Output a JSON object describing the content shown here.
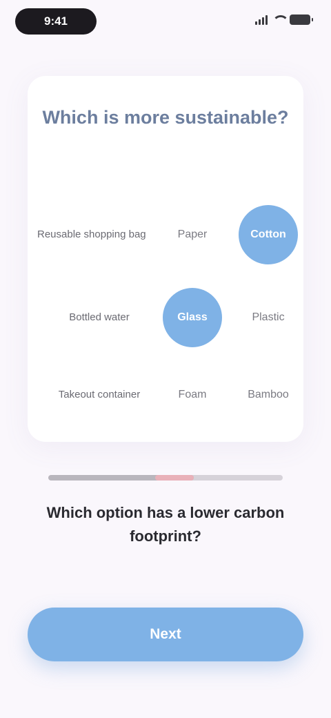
{
  "status_bar": {
    "time": "9:41",
    "icons": [
      "signal-icon",
      "wifi-icon",
      "battery-icon"
    ]
  },
  "card": {
    "title": "Which is more sustainable?",
    "rows": [
      {
        "label": "Reusable shopping bag",
        "option_a": "Paper",
        "option_b": "Cotton",
        "selected": "b"
      },
      {
        "label": "Bottled water",
        "option_a": "Glass",
        "option_b": "Plastic",
        "selected": "a"
      },
      {
        "label": "Takeout container",
        "option_a": "Foam",
        "option_b": "Bamboo",
        "selected": ""
      }
    ]
  },
  "question": {
    "text": "Which option has a lower carbon footprint?",
    "progress": 0.62
  },
  "continue_button": {
    "label": "Next"
  },
  "colors": {
    "accent": "#7fb2e6",
    "background": "#faf7fc",
    "title": "#6c7e9e",
    "progress_marker": "#e9b1b9"
  }
}
